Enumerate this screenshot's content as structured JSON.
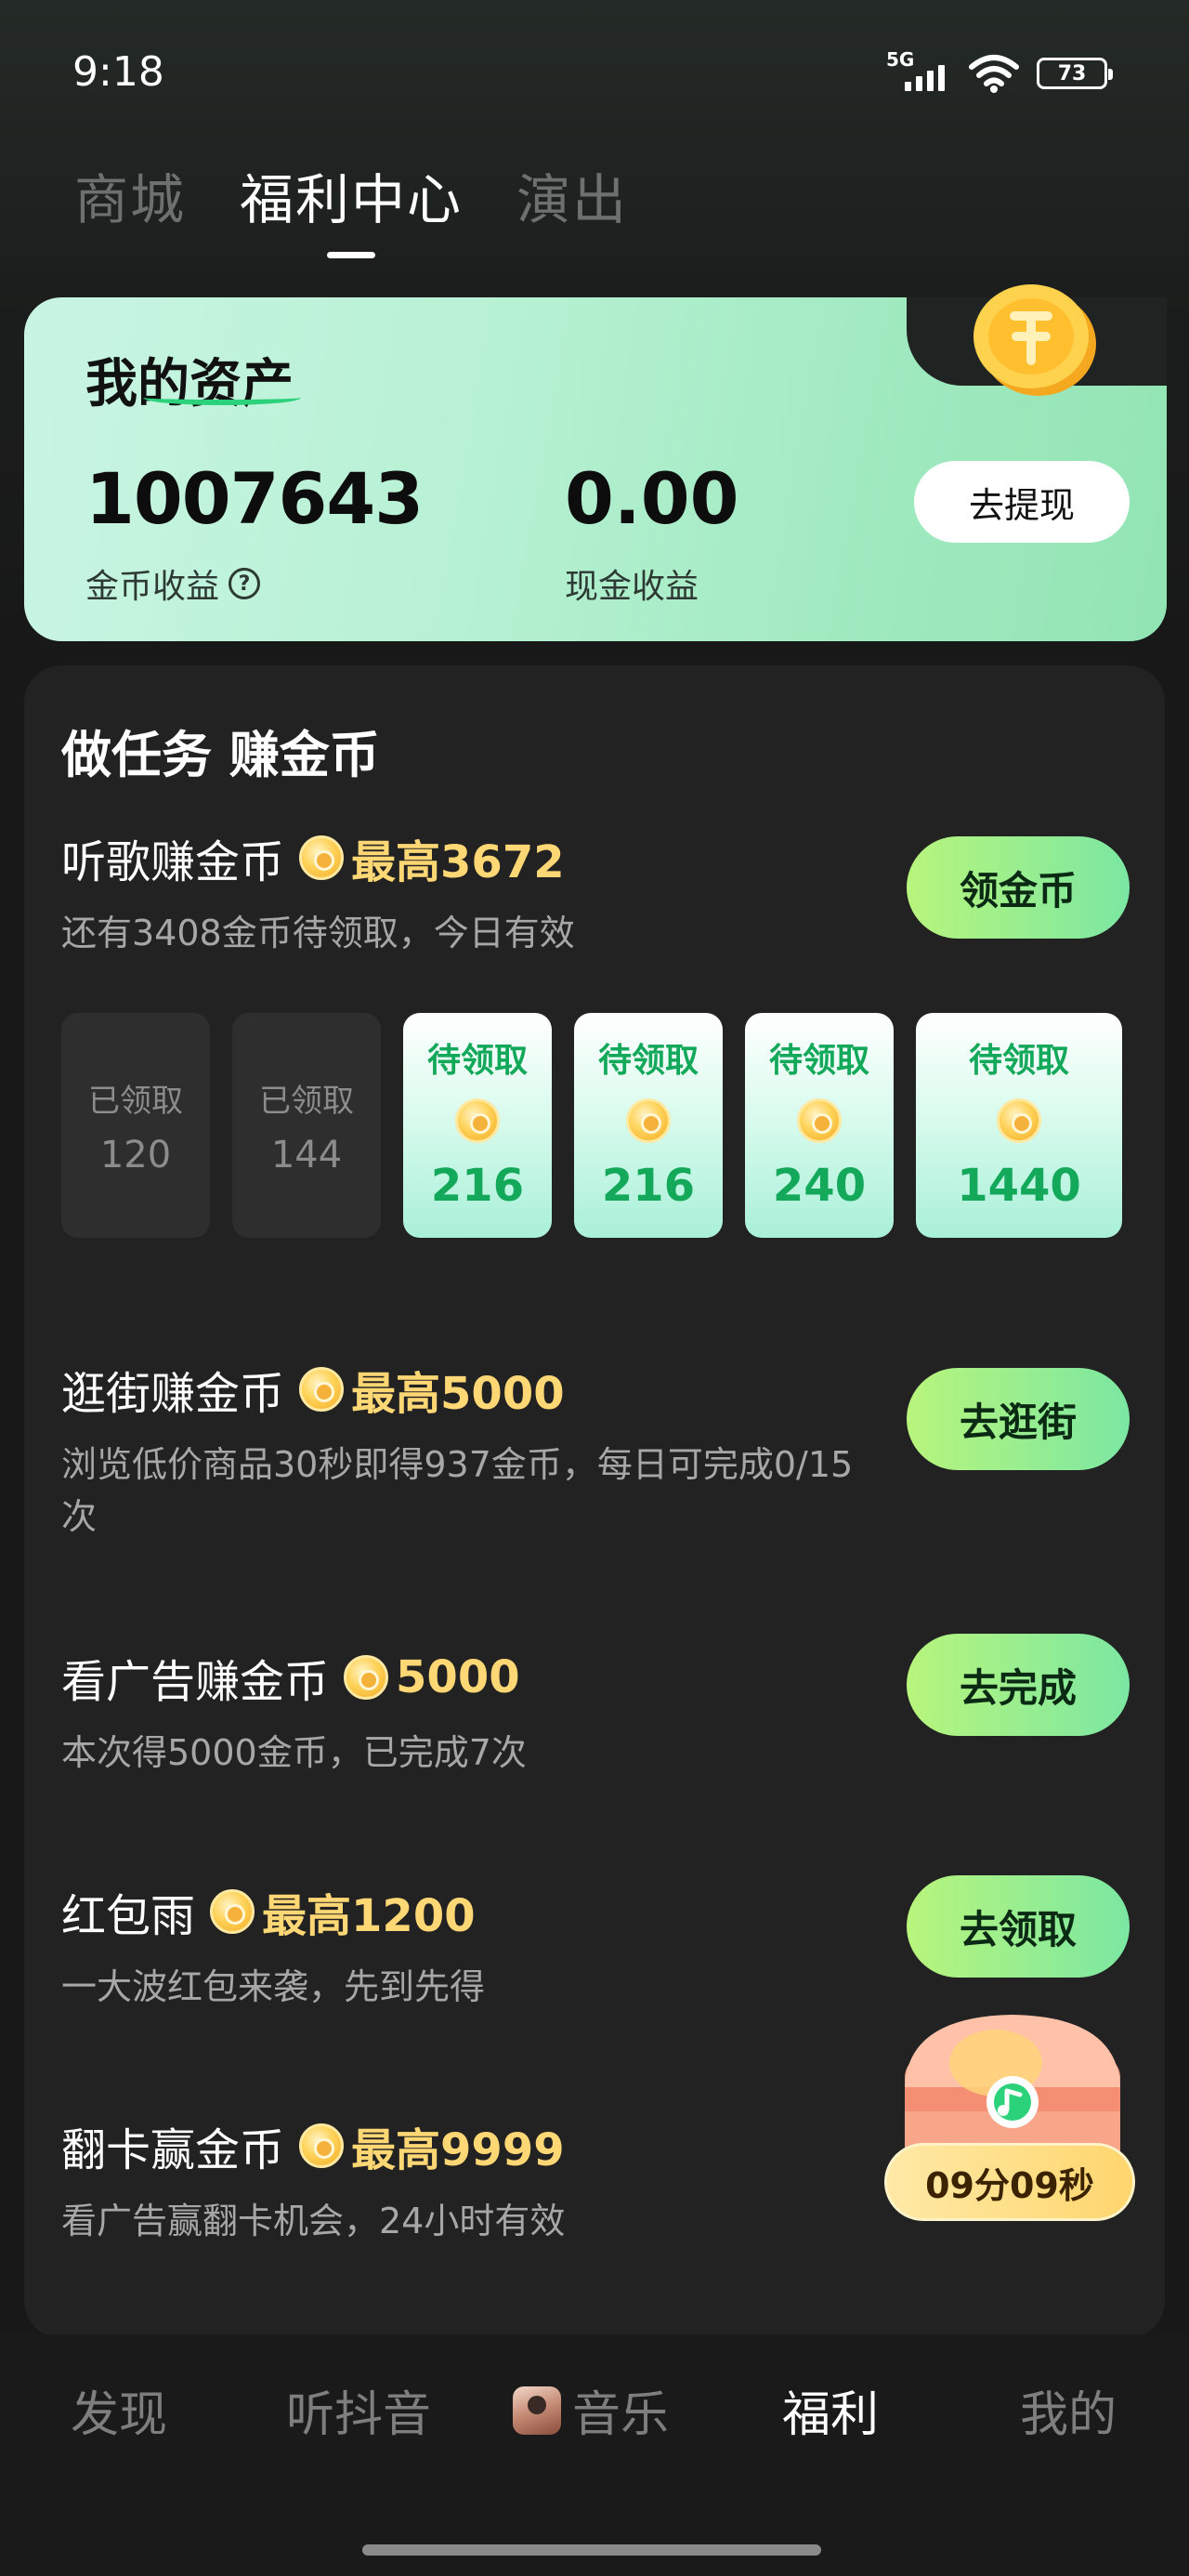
{
  "status_bar": {
    "time": "9:18",
    "network": "5G",
    "battery": "73"
  },
  "top_tabs": [
    {
      "label": "商城",
      "active": false
    },
    {
      "label": "福利中心",
      "active": true
    },
    {
      "label": "演出",
      "active": false
    }
  ],
  "assets": {
    "title": "我的资产",
    "coins_value": "1007643",
    "coins_label": "金币收益",
    "help_icon": "?",
    "cash_value": "0.00",
    "cash_label": "现金收益",
    "withdraw_label": "去提现"
  },
  "tasks": {
    "title": "做任务 赚金币",
    "listen": {
      "name": "听歌赚金币",
      "max": "最高3672",
      "desc": "还有3408金币待领取，今日有效",
      "button": "领金币",
      "slots": [
        {
          "label": "已领取",
          "value": "120"
        },
        {
          "label": "已领取",
          "value": "144"
        },
        {
          "label": "待领取",
          "value": "216"
        },
        {
          "label": "待领取",
          "value": "216"
        },
        {
          "label": "待领取",
          "value": "240"
        },
        {
          "label": "待领取",
          "value": "1440"
        }
      ]
    },
    "shop": {
      "name": "逛街赚金币",
      "max": "最高5000",
      "desc": "浏览低价商品30秒即得937金币，每日可完成0/15次",
      "button": "去逛街"
    },
    "ad": {
      "name": "看广告赚金币",
      "max": "5000",
      "desc": "本次得5000金币，已完成7次",
      "button": "去完成"
    },
    "redpacket": {
      "name": "红包雨",
      "max": "最高1200",
      "desc": "一大波红包来袭，先到先得",
      "button": "去领取"
    },
    "flip": {
      "name": "翻卡赢金币",
      "max": "最高9999",
      "desc": "看广告赢翻卡机会，24小时有效"
    }
  },
  "treasure_timer": "09分09秒",
  "bottom_nav": [
    {
      "label": "发现",
      "active": false
    },
    {
      "label": "听抖音",
      "active": false
    },
    {
      "label": "音乐",
      "active": false
    },
    {
      "label": "福利",
      "active": true
    },
    {
      "label": "我的",
      "active": false
    }
  ],
  "colors": {
    "accent_green": "#7be7a2",
    "coin_gold": "#ffd774",
    "pending_green": "#13a85a"
  }
}
